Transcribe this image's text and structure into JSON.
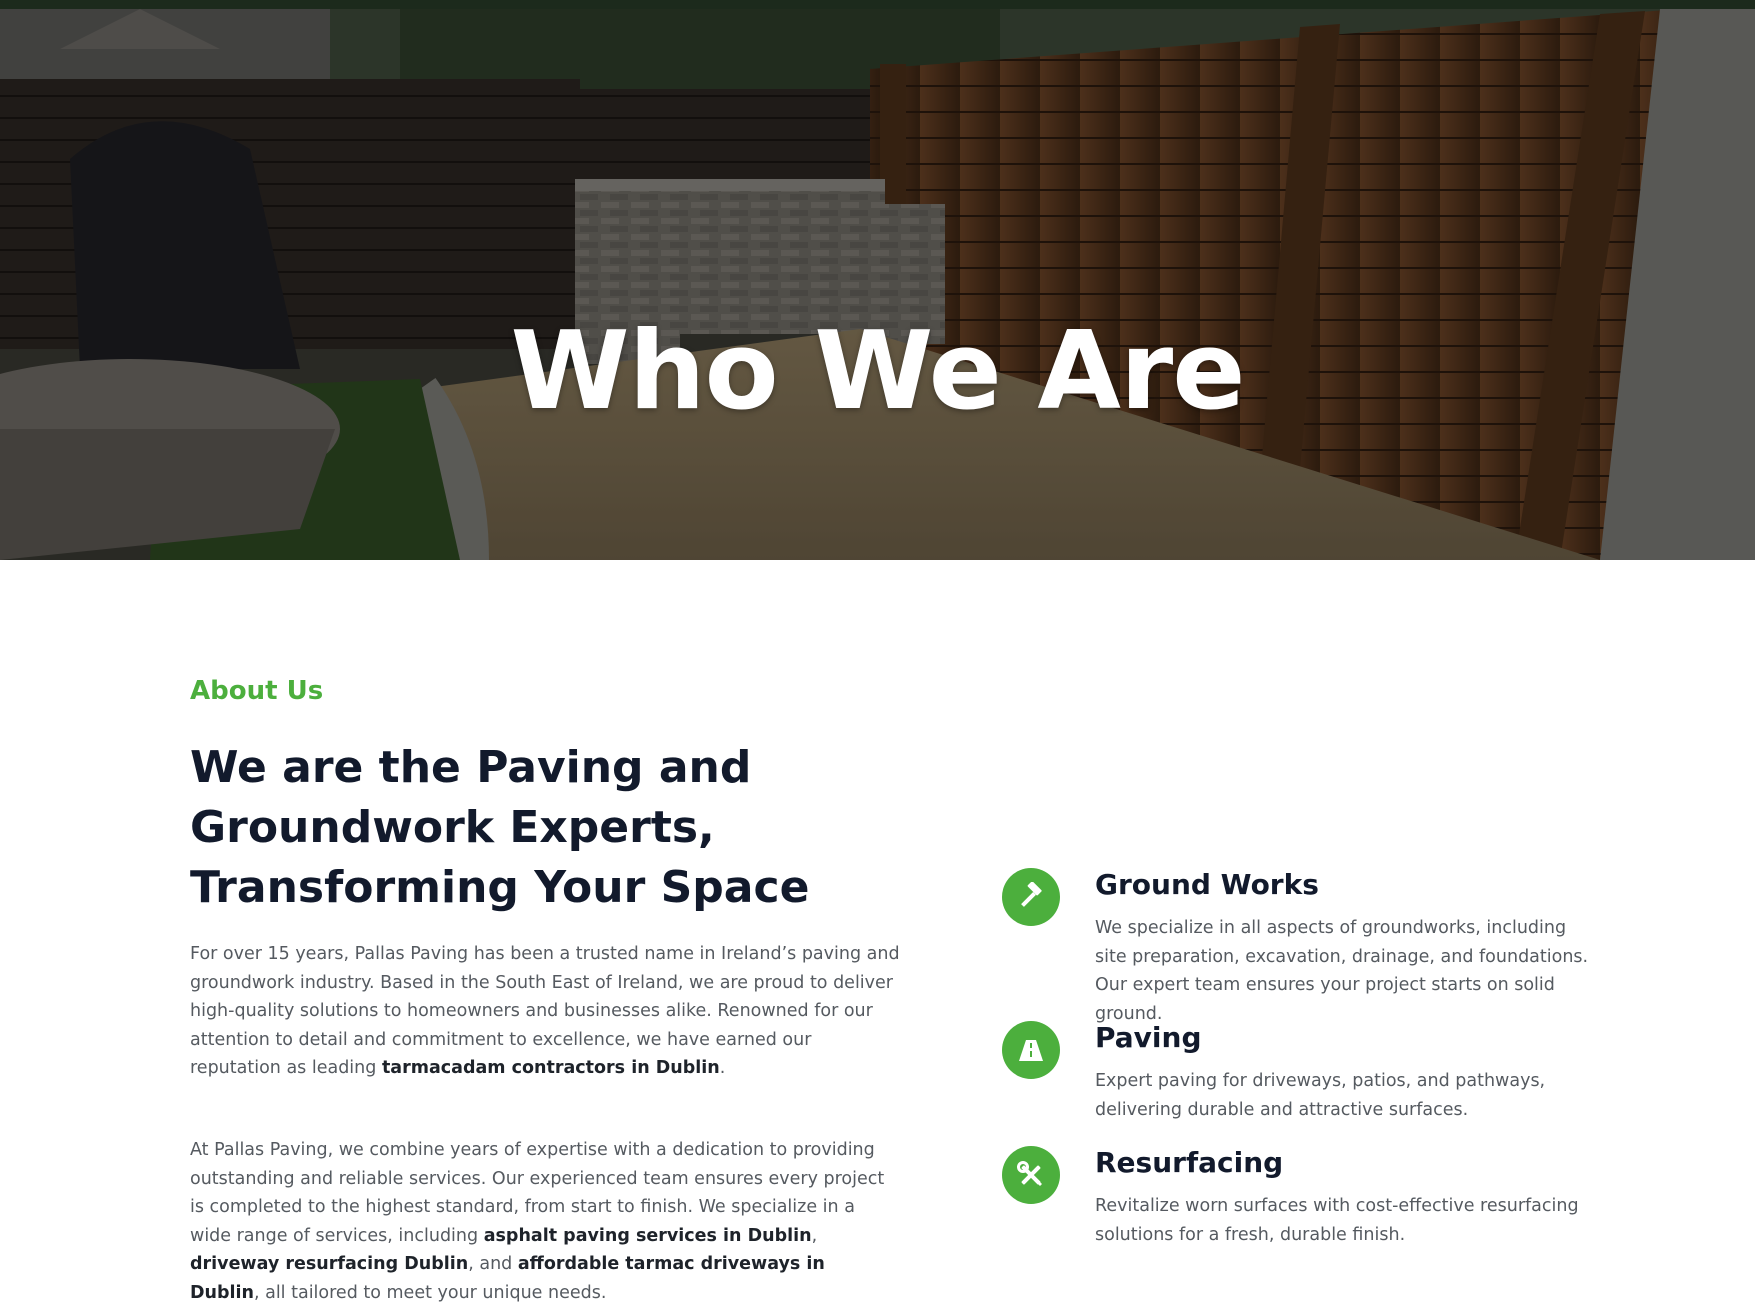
{
  "hero": {
    "title": "Who We Are",
    "image_description_icon": "garden-patio-photo"
  },
  "about": {
    "eyebrow": "About Us",
    "headline": "We are the Paving and Groundwork Experts, Transforming Your Space",
    "paragraph1": {
      "text": "For over 15 years, Pallas Paving has been a trusted name in Ireland’s paving and groundwork industry. Based in the South East of Ireland, we are proud to deliver high-quality solutions to homeowners and businesses alike. Renowned for our attention to detail and commitment to excellence, we have earned our reputation as leading ",
      "link": "tarmacadam contractors in Dublin",
      "end": "."
    },
    "paragraph2": {
      "text": "At Pallas Paving, we combine years of expertise with a dedication to providing outstanding and reliable services. Our experienced team ensures every project is completed to the highest standard, from start to finish. We specialize in a wide range of services, including ",
      "link1": "asphalt paving services in Dublin",
      "sep1": ", ",
      "link2": "driveway resurfacing Dublin",
      "sep2": ", and ",
      "link3": "affordable tarmac driveways in Dublin",
      "end": ", all tailored to meet your unique needs."
    }
  },
  "services": [
    {
      "icon": "hammer-icon",
      "title": "Ground Works",
      "description": "We specialize in all aspects of groundworks, including site preparation, excavation, drainage, and foundations. Our expert team ensures your project starts on solid ground."
    },
    {
      "icon": "road-icon",
      "title": "Paving",
      "description": "Expert paving for driveways, patios, and pathways, delivering durable and attractive surfaces."
    },
    {
      "icon": "tools-icon",
      "title": "Resurfacing",
      "description": "Revitalize worn surfaces with cost-effective resurfacing solutions for a fresh, durable finish."
    }
  ],
  "colors": {
    "accent_green": "#4caf3d",
    "heading_navy": "#121a2c",
    "body_gray": "#555a60"
  }
}
